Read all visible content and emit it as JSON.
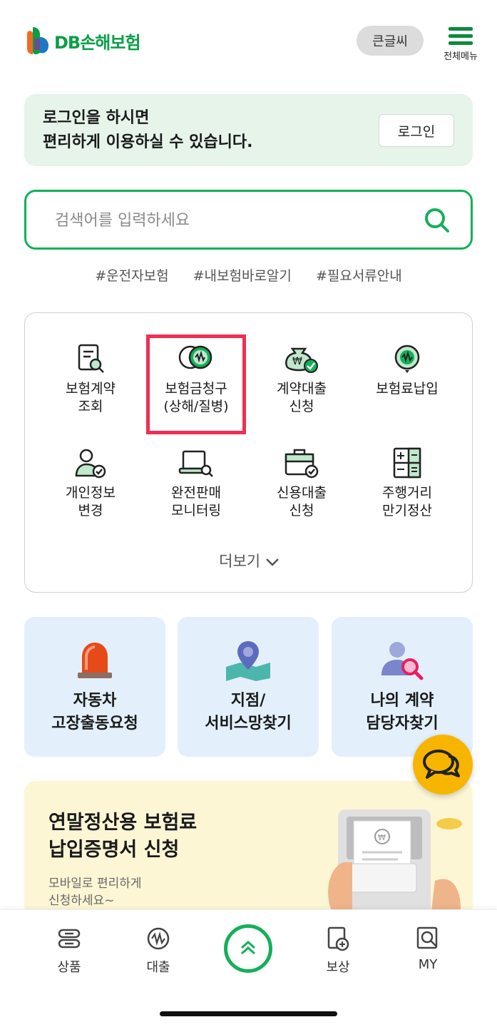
{
  "header": {
    "logo_text": "DB손해보험",
    "bigfont_label": "큰글씨",
    "menu_label": "전체메뉴"
  },
  "login": {
    "line1": "로그인을 하시면",
    "line2": "편리하게 이용하실 수 있습니다.",
    "button": "로그인"
  },
  "search": {
    "placeholder": "검색어를 입력하세요"
  },
  "tags": [
    "#운전자보험",
    "#내보험바로알기",
    "#필요서류안내"
  ],
  "services": [
    {
      "line1": "보험계약",
      "line2": "조회",
      "icon": "document-search-icon"
    },
    {
      "line1": "보험금청구",
      "line2": "(상해/질병)",
      "icon": "coin-won-icon"
    },
    {
      "line1": "계약대출",
      "line2": "신청",
      "icon": "money-bag-check-icon"
    },
    {
      "line1": "보험료납입",
      "line2": "",
      "icon": "won-circle-arrow-icon"
    },
    {
      "line1": "개인정보",
      "line2": "변경",
      "icon": "user-check-icon"
    },
    {
      "line1": "완전판매",
      "line2": "모니터링",
      "icon": "laptop-search-icon"
    },
    {
      "line1": "신용대출",
      "line2": "신청",
      "icon": "briefcase-check-icon"
    },
    {
      "line1": "주행거리",
      "line2": "만기정산",
      "icon": "calculator-icon"
    }
  ],
  "more_label": "더보기",
  "quick": [
    {
      "line1": "자동차",
      "line2": "고장출동요청",
      "icon": "siren-icon"
    },
    {
      "line1": "지점/",
      "line2": "서비스망찾기",
      "icon": "map-pin-icon"
    },
    {
      "line1": "나의 계약",
      "line2": "담당자찾기",
      "icon": "person-search-icon"
    }
  ],
  "promo": {
    "title1": "연말정산용 보험료",
    "title2": "납입증명서 신청",
    "sub1": "모바일로 편리하게",
    "sub2": "신청하세요~"
  },
  "bottom_nav": [
    {
      "label": "상품",
      "icon": "product-icon"
    },
    {
      "label": "대출",
      "icon": "loan-icon"
    },
    {
      "label": "보상",
      "icon": "claim-icon"
    },
    {
      "label": "MY",
      "icon": "my-search-icon"
    }
  ],
  "colors": {
    "brand_green": "#14b05a",
    "highlight_red": "#ef2f52",
    "chat_yellow": "#f8b500"
  }
}
